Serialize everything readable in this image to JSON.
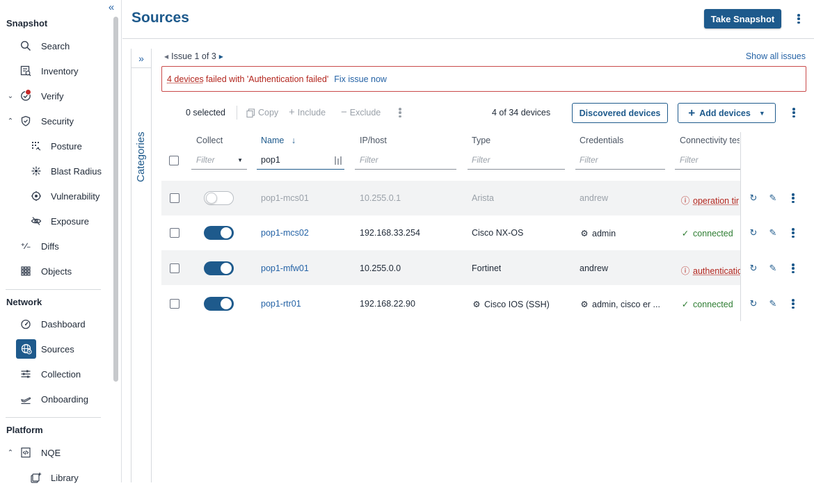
{
  "sidebar": {
    "collapse_icon": "double-chevron-left-icon",
    "sections": {
      "snapshot": "Snapshot",
      "network": "Network",
      "platform": "Platform"
    },
    "items": {
      "search": "Search",
      "inventory": "Inventory",
      "verify": "Verify",
      "security": "Security",
      "posture": "Posture",
      "blast_radius": "Blast Radius",
      "vulnerability": "Vulnerability",
      "exposure": "Exposure",
      "diffs": "Diffs",
      "objects": "Objects",
      "dashboard": "Dashboard",
      "sources": "Sources",
      "collection": "Collection",
      "onboarding": "Onboarding",
      "nqe": "NQE",
      "library": "Library"
    },
    "active": "sources",
    "accent": "#1e5a8c",
    "alert_color": "#c62828"
  },
  "header": {
    "title": "Sources",
    "take_snapshot": "Take Snapshot"
  },
  "categories": {
    "label": "Categories"
  },
  "issue": {
    "nav": "Issue 1 of 3",
    "show_all": "Show all issues",
    "devices_link": "4 devices",
    "message": "failed with 'Authentication failed'",
    "fix": "Fix issue now"
  },
  "toolbar": {
    "selected": "0 selected",
    "copy": "Copy",
    "include": "Include",
    "exclude": "Exclude",
    "count": "4 of 34 devices",
    "discovered": "Discovered devices",
    "add": "Add devices"
  },
  "table": {
    "columns": {
      "collect": "Collect",
      "name": "Name",
      "ip": "IP/host",
      "type": "Type",
      "credentials": "Credentials",
      "connectivity": "Connectivity tes"
    },
    "filters": {
      "placeholder": "Filter",
      "name_value": "pop1"
    },
    "rows": [
      {
        "collect": false,
        "name": "pop1-mcs01",
        "ip": "10.255.0.1",
        "type": "Arista",
        "type_icon": false,
        "credentials": "andrew",
        "cred_icon": false,
        "status": "operation tir",
        "status_kind": "error"
      },
      {
        "collect": true,
        "name": "pop1-mcs02",
        "ip": "192.168.33.254",
        "type": "Cisco NX-OS",
        "type_icon": false,
        "credentials": "admin",
        "cred_icon": true,
        "status": "connected",
        "status_kind": "ok"
      },
      {
        "collect": true,
        "name": "pop1-mfw01",
        "ip": "10.255.0.0",
        "type": "Fortinet",
        "type_icon": false,
        "credentials": "andrew",
        "cred_icon": false,
        "status": "authenticatio",
        "status_kind": "error"
      },
      {
        "collect": true,
        "name": "pop1-rtr01",
        "ip": "192.168.22.90",
        "type": "Cisco IOS (SSH)",
        "type_icon": true,
        "credentials": "admin, cisco er ...",
        "cred_icon": true,
        "status": "connected",
        "status_kind": "ok"
      }
    ]
  }
}
